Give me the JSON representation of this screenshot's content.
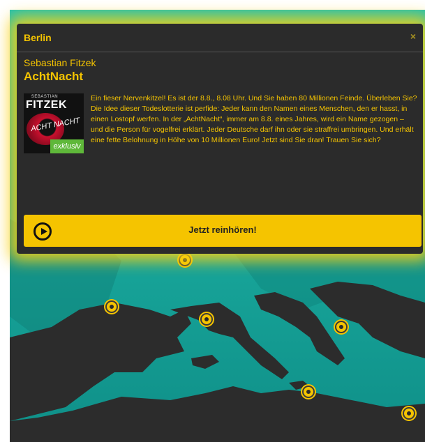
{
  "popup": {
    "city": "Berlin",
    "close_icon": "×",
    "author": "Sebastian Fitzek",
    "title": "AchtNacht",
    "cover": {
      "author_first": "SEBASTIAN",
      "author_last": "FITZEK",
      "title": "ACHT NACHT",
      "badge": "exklusiv"
    },
    "description": "Ein fieser Nervenkitzel! Es ist der 8.8., 8.08 Uhr. Und Sie haben 80 Millionen Feinde. Überleben Sie? Die Idee dieser Todeslotterie ist perfide: Jeder kann den Namen eines Menschen, den er hasst, in einen Lostopf werfen. In der „AchtNacht“, immer am 8.8. eines Jahres, wird ein Name gezogen – und die Person für vogelfrei erklärt. Jeder Deutsche darf ihn oder sie straffrei umbringen. Und erhält eine fette Belohnung in Höhe von 10 Millionen Euro! Jetzt sind Sie dran! Trauen Sie sich?",
    "listen_button": "Jetzt reinhören!",
    "play_icon": "play-circle-icon",
    "accent_color": "#f5c400"
  },
  "map": {
    "marker_icon": "location-pin-icon"
  }
}
